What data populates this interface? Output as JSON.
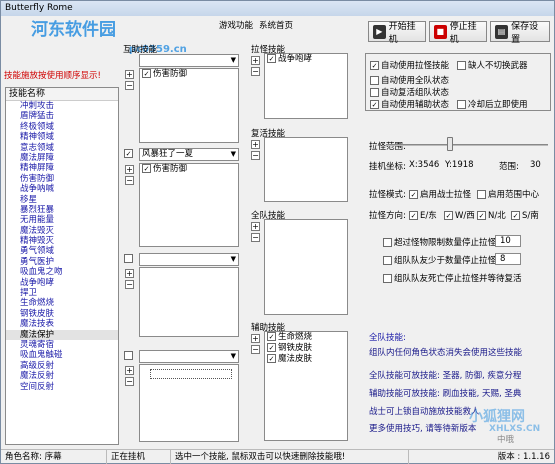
{
  "window": {
    "title": "Butterfly Rome"
  },
  "menu": [
    "游戏功能",
    "系统首页"
  ],
  "toolbar": {
    "start": "开始挂机",
    "stop": "停止挂机",
    "save": "保存设置"
  },
  "warning": "技能施放按使用顺序显示!",
  "skill_list": {
    "header": "技能名称",
    "items": [
      "冲刺攻击",
      "盾牌猛击",
      "终极领域",
      "精神领域",
      "意志领域",
      "魔法屏障",
      "精神屏障",
      "伤害防御",
      "战争呐喊",
      "移星",
      "暴烈狂暴",
      "无用能量",
      "魔法毁灭",
      "精神毁灭",
      "勇气领域",
      "勇气医护",
      "吸血鬼之吻",
      "战争咆哮",
      "捍卫",
      "生命燃烧",
      "钢铁皮肤",
      "魔法技表",
      "魔法保护",
      "灵魂寄宿",
      "吸血鬼触碰",
      "高级反射",
      "魔法反射",
      "空间反射"
    ],
    "selected_index": 22
  },
  "mutual": {
    "title": "互助技能",
    "combo1": "",
    "list1": [
      {
        "checked": true,
        "label": "伤害防御"
      }
    ],
    "check2": true,
    "combo2": "风暴狂了一夏",
    "list2": [
      {
        "checked": true,
        "label": "伤害防御"
      }
    ],
    "check3": false,
    "combo3": "",
    "check4": false,
    "combo4": ""
  },
  "pull": {
    "title": "拉怪技能",
    "items": [
      {
        "checked": true,
        "label": "战争咆哮"
      }
    ]
  },
  "revive": {
    "title": "复活技能"
  },
  "team": {
    "title": "全队技能"
  },
  "aux": {
    "title": "辅助技能",
    "items": [
      {
        "checked": true,
        "label": "生命燃烧"
      },
      {
        "checked": true,
        "label": "钢铁皮肤"
      },
      {
        "checked": true,
        "label": "魔法皮肤"
      }
    ]
  },
  "options": [
    {
      "checked": true,
      "label": "自动使用拉怪技能"
    },
    {
      "checked": false,
      "label": "缺人不切换武器"
    },
    {
      "checked": false,
      "label": "自动使用全队状态"
    },
    {
      "checked": false,
      "label": "自动复活组队状态"
    },
    {
      "checked": true,
      "label": "自动使用辅助状态"
    },
    {
      "checked": false,
      "label": "冷却后立即使用"
    }
  ],
  "pull_range": {
    "label": "拉怪范围:",
    "value": 0.4
  },
  "coords": {
    "label": "挂机坐标:",
    "x": "X:3546",
    "y": "Y:1918",
    "range_label": "范围:",
    "range": "30"
  },
  "pull_mode": {
    "label": "拉怪模式:",
    "opt1": "启用战士拉怪",
    "opt1_checked": true,
    "opt2": "启用范围中心",
    "opt2_checked": false
  },
  "pull_dir": {
    "label": "拉怪方向:",
    "dirs": [
      {
        "checked": true,
        "label": "E/东"
      },
      {
        "checked": true,
        "label": "W/西"
      },
      {
        "checked": true,
        "label": "N/北"
      },
      {
        "checked": true,
        "label": "S/南"
      }
    ]
  },
  "stops": [
    {
      "checked": false,
      "label": "超过怪物限制数量停止拉怪",
      "value": "10"
    },
    {
      "checked": false,
      "label": "组队队友少于数量停止拉怪",
      "value": "8"
    },
    {
      "checked": false,
      "label": "组队队友死亡停止拉怪并等待复活",
      "value": ""
    }
  ],
  "info": {
    "h1": "全队技能:",
    "l1": "组队内任何角色状态消失会使用这些技能",
    "l2": "全队技能可放技能: 圣器, 防御, 疾意分程",
    "l3": "辅助技能可放技能: 刷血技能, 天赐, 圣典",
    "l4": "战士可上锁自动施放技能救人",
    "l5": "更多使用技巧, 请等待新版本",
    "l5_tail": "中哦"
  },
  "status": {
    "role": "角色名称: 序幕",
    "state": "正在挂机",
    "hint": "选中一个技能, 鼠标双击可以快速删除技能哦!",
    "version": "版本 : 1.1.16"
  },
  "watermark": {
    "site": "河东软件园",
    "url": "pc0359.cn",
    "brand2": "小狐狸网",
    "url2": "XHLXS.CN"
  }
}
